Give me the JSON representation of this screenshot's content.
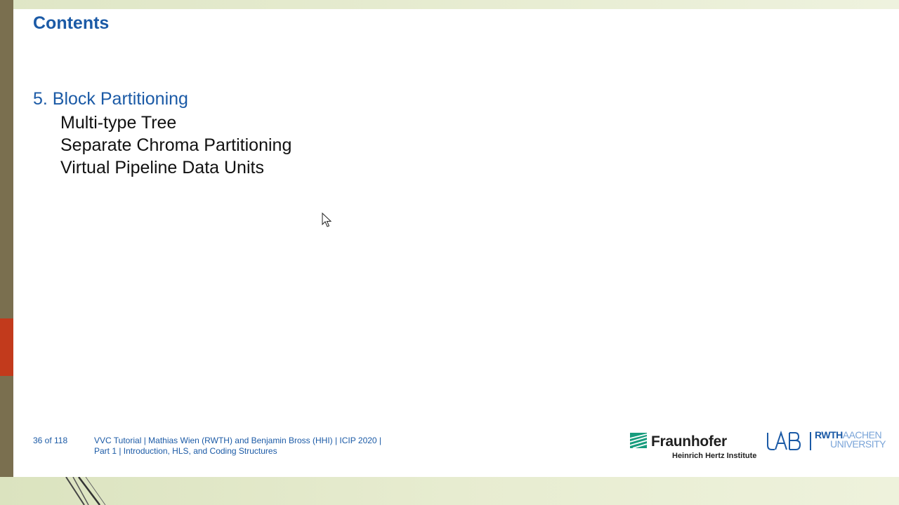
{
  "slide": {
    "title": "Contents",
    "section": "5. Block Partitioning",
    "items": [
      "Multi-type Tree",
      "Separate Chroma Partitioning",
      "Virtual Pipeline Data Units"
    ]
  },
  "footer": {
    "page": "36 of 118",
    "line1": "VVC Tutorial  |  Mathias Wien (RWTH) and Benjamin Bross (HHI)  |  ICIP 2020  |",
    "line2": "Part 1  |  Introduction, HLS, and Coding Structures"
  },
  "logos": {
    "fraunhofer_name": "Fraunhofer",
    "fraunhofer_sub": "Heinrich Hertz Institute",
    "uab": "UAB",
    "rwth_part1": "RWTH",
    "rwth_part2": "AACHEN",
    "rwth_part3": "UNIVERSITY"
  },
  "colors": {
    "title": "#1b5aa6",
    "left_bar": "#7a6f4f",
    "left_accent": "#c23a1c",
    "band": "#e3e9c9",
    "fraunhofer_green": "#179c7d"
  },
  "icons": [
    "fraunhofer-logo-icon",
    "mouse-cursor-icon",
    "uab-logo-icon"
  ]
}
